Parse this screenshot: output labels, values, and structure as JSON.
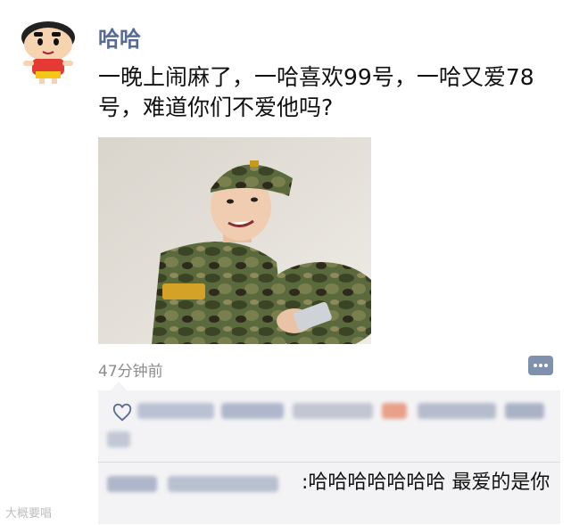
{
  "post": {
    "username": "哈哈",
    "text": "一晚上闹麻了，一哈喜欢99号，一哈又爱78号，难道你们不爱他吗?",
    "timestamp": "47分钟前"
  },
  "comments": [
    {
      "text": ":哈哈哈哈哈哈哈  最爱的是你"
    }
  ],
  "watermark": "大概要唱",
  "colors": {
    "link_blue": "#576b95",
    "comment_bg": "#f3f3f5"
  }
}
